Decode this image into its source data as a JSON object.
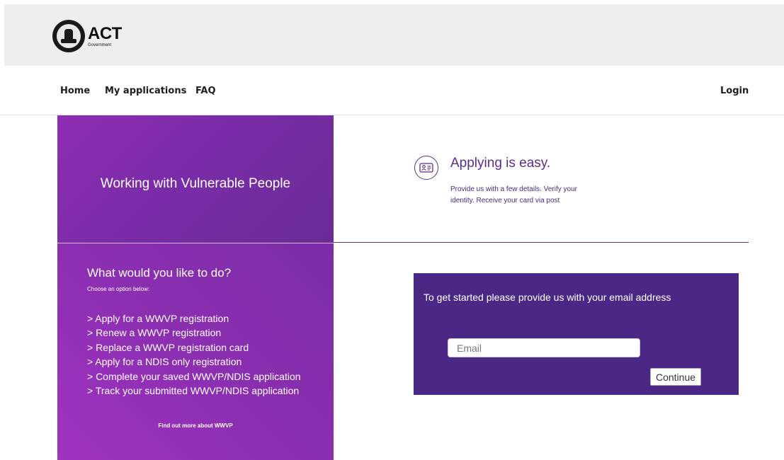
{
  "header": {
    "logo_title": "ACT",
    "logo_subtitle": "Government"
  },
  "nav": {
    "items": [
      {
        "label": "Home"
      },
      {
        "label": "My applications"
      },
      {
        "label": "FAQ"
      }
    ],
    "login_label": "Login"
  },
  "hero": {
    "title": "Working with Vulnerable People"
  },
  "intro": {
    "icon": "id-card-icon",
    "title": "Applying is easy.",
    "description": "Provide us with a few details. Verify your identity. Receive your card via post"
  },
  "options_panel": {
    "title": "What would you like to do?",
    "subtitle": "Choose an option below:",
    "options": [
      "> Apply for a WWVP registration",
      "> Renew a WWVP registration",
      "> Replace a WWVP registration card",
      "> Apply for a NDIS only registration",
      "> Complete your saved WWVP/NDIS application",
      "> Track your submitted WWVP/NDIS application"
    ],
    "find_more_label": "Find out more about WWVP"
  },
  "email_form": {
    "prompt": "To get started please provide us with your email address",
    "input_value": "",
    "input_placeholder": "Email",
    "continue_label": "Continue"
  },
  "colors": {
    "header_bg": "#eceeef",
    "purple_dark": "#4b2886",
    "purple_gradient_start": "#8e2db4",
    "purple_gradient_end": "#6a2b96",
    "accent_text": "#5b2d8e"
  }
}
